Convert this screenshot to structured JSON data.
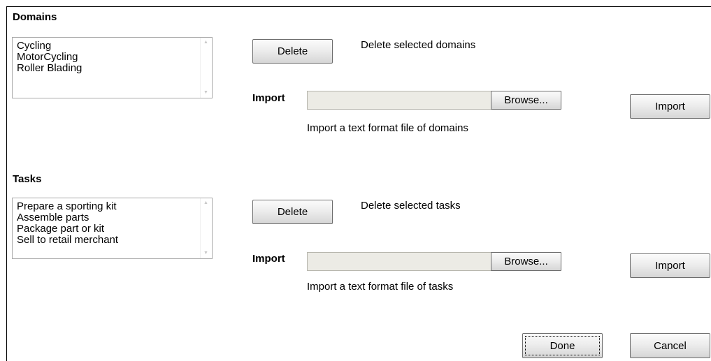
{
  "domains": {
    "title": "Domains",
    "items": [
      "Cycling",
      "MotorCycling",
      "Roller Blading"
    ],
    "delete_label": "Delete",
    "delete_desc": "Delete selected domains",
    "import_label": "Import",
    "file_value": "",
    "browse_label": "Browse...",
    "import_button_label": "Import",
    "import_desc": "Import a text format file of domains"
  },
  "tasks": {
    "title": "Tasks",
    "items": [
      "Prepare a sporting kit",
      "Assemble parts",
      "Package part or kit",
      "Sell to retail merchant"
    ],
    "delete_label": "Delete",
    "delete_desc": "Delete selected tasks",
    "import_label": "Import",
    "file_value": "",
    "browse_label": "Browse...",
    "import_button_label": "Import",
    "import_desc": "Import a text format file of tasks"
  },
  "footer": {
    "done_label": "Done",
    "cancel_label": "Cancel"
  }
}
